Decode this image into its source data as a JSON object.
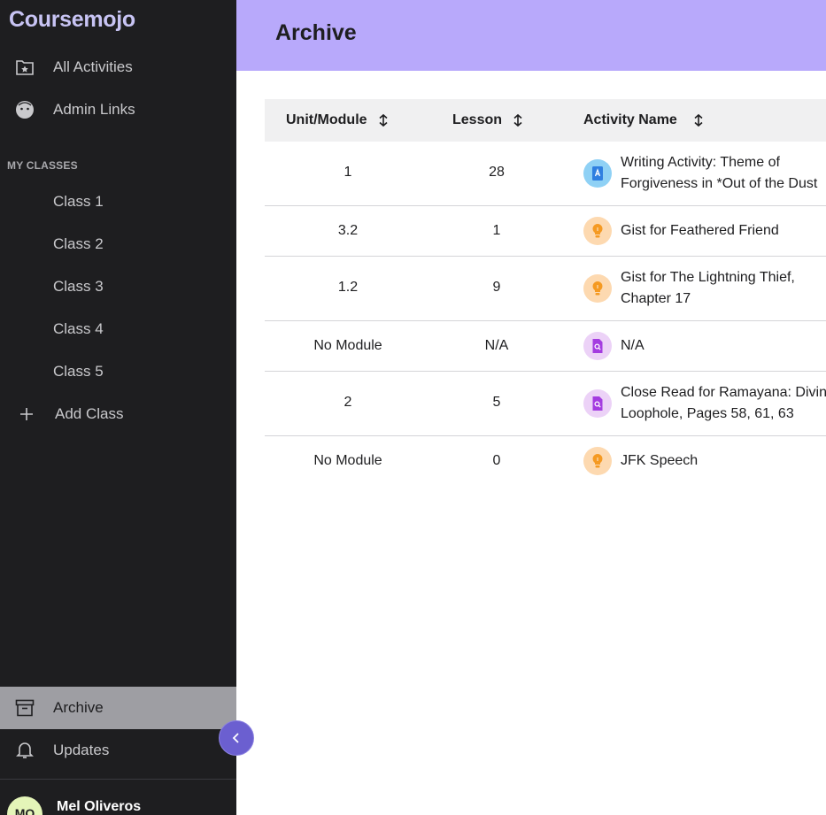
{
  "app": {
    "logo": "Coursemojo"
  },
  "sidebar": {
    "top_items": [
      {
        "label": "All Activities",
        "icon": "star-folder-icon"
      },
      {
        "label": "Admin Links",
        "icon": "face-icon"
      }
    ],
    "section_label": "MY CLASSES",
    "classes": [
      {
        "label": "Class 1"
      },
      {
        "label": "Class 2"
      },
      {
        "label": "Class 3"
      },
      {
        "label": "Class 4"
      },
      {
        "label": "Class 5"
      }
    ],
    "add_class_label": "Add Class",
    "bottom_items": [
      {
        "label": "Archive",
        "icon": "archive-box-icon",
        "active": true
      },
      {
        "label": "Updates",
        "icon": "bell-icon"
      }
    ],
    "user": {
      "initials": "MO",
      "name": "Mel Oliveros"
    }
  },
  "header": {
    "title": "Archive"
  },
  "table": {
    "columns": [
      "Unit/Module",
      "Lesson",
      "Activity Name"
    ],
    "rows": [
      {
        "unit": "1",
        "lesson": "28",
        "type": "writing",
        "name": [
          "Writing Activity: Theme of",
          "Forgiveness in *Out of the Dust"
        ]
      },
      {
        "unit": "3.2",
        "lesson": "1",
        "type": "gist",
        "name": [
          "Gist for Feathered Friend"
        ]
      },
      {
        "unit": "1.2",
        "lesson": "9",
        "type": "gist",
        "name": [
          "Gist for The Lightning Thief,",
          "Chapter 17"
        ]
      },
      {
        "unit": "No Module",
        "lesson": "N/A",
        "type": "close-read",
        "name": [
          "N/A"
        ]
      },
      {
        "unit": "2",
        "lesson": "5",
        "type": "close-read",
        "name": [
          "Close Read for Ramayana: Divine",
          "Loophole, Pages 58, 61, 63"
        ]
      },
      {
        "unit": "No Module",
        "lesson": "0",
        "type": "gist",
        "name": [
          "JFK Speech"
        ]
      }
    ]
  },
  "colors": {
    "sidebar_bg": "#1e1e20",
    "header_bg": "#b8a9fb",
    "logo": "#c8c4f4",
    "active_bg": "#9e9ea3",
    "collapse_btn": "#6b5fd0",
    "writing_icon_bg": "#8fd1f5",
    "gist_icon_bg": "#fdd9b0",
    "close_read_icon_bg": "#ecd2f7"
  }
}
